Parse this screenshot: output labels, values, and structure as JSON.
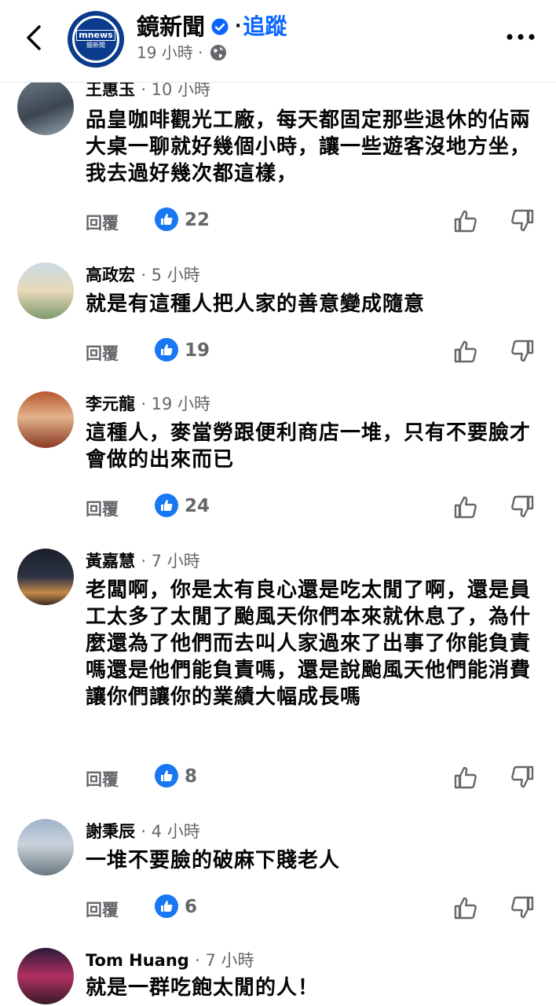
{
  "header": {
    "logo_line1": "mnews",
    "logo_line2": "鏡新聞",
    "page_name": "鏡新聞",
    "separator": "·",
    "follow_label": "追蹤",
    "post_time": "19 小時 ·",
    "icons": {
      "back": "chevron-left-icon",
      "verified": "verified-badge-icon",
      "audience": "globe-icon",
      "more": "more-horizontal-icon"
    }
  },
  "reply_label": "回覆",
  "colors": {
    "accent": "#0866ff",
    "like_badge": "#1877f2",
    "muted": "#65676b"
  },
  "comments": [
    {
      "author": "王惠玉",
      "time": "· 10 小時",
      "text": "品皇咖啡觀光工廠，每天都固定那些退休的佔兩大桌一聊就好幾個小時，讓一些遊客沒地方坐，我去過好幾次都這樣，",
      "likes": "22"
    },
    {
      "author": "高政宏",
      "time": "· 5 小時",
      "text": "就是有這種人把人家的善意變成隨意",
      "likes": "19"
    },
    {
      "author": "李元龍",
      "time": "· 19 小時",
      "text": "這種人，麥當勞跟便利商店一堆，只有不要臉才會做的出來而已",
      "likes": "24"
    },
    {
      "author": "黃嘉慧",
      "time": "· 7 小時",
      "text": "老闆啊，你是太有良心還是吃太閒了啊，還是員工太多了太閒了颱風天你們本來就休息了，為什麼還為了他們而去叫人家過來了出事了你能負責嗎還是他們能負責嗎，還是說颱風天他們能消費讓你們讓你的業績大幅成長嗎",
      "likes": "8"
    },
    {
      "author": "謝秉辰",
      "time": "· 4 小時",
      "text": "一堆不要臉的破麻下賤老人",
      "likes": "6"
    },
    {
      "author": "Tom Huang",
      "time": "· 7 小時",
      "text": "就是一群吃飽太閒的人！",
      "likes": ""
    }
  ]
}
